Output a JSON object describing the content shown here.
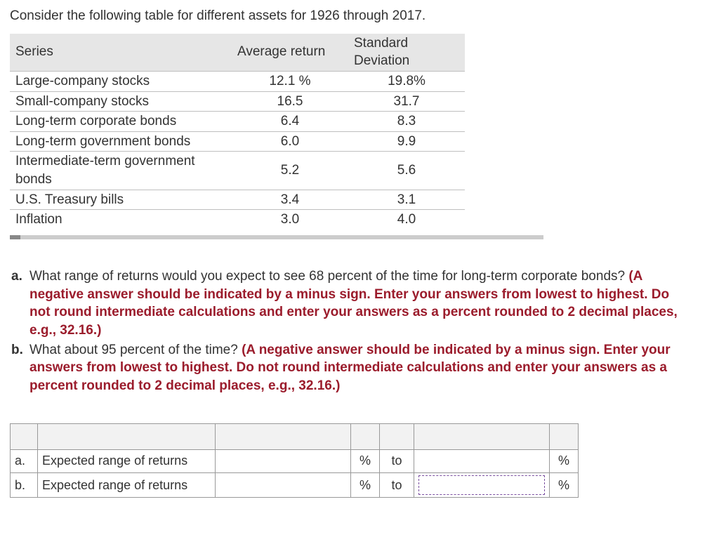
{
  "prompt": "Consider the following table for different assets for 1926 through 2017.",
  "table": {
    "headers": [
      "Series",
      "Average return",
      "Standard Deviation"
    ],
    "rows": [
      {
        "series": "Large-company stocks",
        "avg": "12.1 %",
        "sd": "19.8%"
      },
      {
        "series": "Small-company stocks",
        "avg": "16.5",
        "sd": "31.7"
      },
      {
        "series": "Long-term corporate bonds",
        "avg": "6.4",
        "sd": "8.3"
      },
      {
        "series": "Long-term government bonds",
        "avg": "6.0",
        "sd": "9.9"
      },
      {
        "series": "Intermediate-term government bonds",
        "avg": "5.2",
        "sd": "5.6"
      },
      {
        "series": "U.S. Treasury bills",
        "avg": "3.4",
        "sd": "3.1"
      },
      {
        "series": "Inflation",
        "avg": "3.0",
        "sd": "4.0"
      }
    ]
  },
  "questions": {
    "a": {
      "marker": "a.",
      "text": "What range of returns would you expect to see 68 percent of the time for long-term corporate bonds? ",
      "instr": "(A negative answer should be indicated by a minus sign. Enter your answers from lowest to highest. Do not round intermediate calculations and enter your answers as a percent rounded to 2 decimal places, e.g., 32.16.)"
    },
    "b": {
      "marker": "b.",
      "text": "What about 95 percent of the time? ",
      "instr": "(A negative answer should be indicated by a minus sign. Enter your answers from lowest to highest. Do not round intermediate calculations and enter your answers as a percent rounded to 2 decimal places, e.g., 32.16.)"
    }
  },
  "answer_table": {
    "rows": [
      {
        "idx": "a.",
        "label": "Expected range of returns",
        "pct": "%",
        "to": "to"
      },
      {
        "idx": "b.",
        "label": "Expected range of returns",
        "pct": "%",
        "to": "to"
      }
    ]
  },
  "chart_data": {
    "type": "table",
    "title": "Asset returns 1926–2017",
    "columns": [
      "Series",
      "Average return (%)",
      "Standard Deviation (%)"
    ],
    "rows": [
      [
        "Large-company stocks",
        12.1,
        19.8
      ],
      [
        "Small-company stocks",
        16.5,
        31.7
      ],
      [
        "Long-term corporate bonds",
        6.4,
        8.3
      ],
      [
        "Long-term government bonds",
        6.0,
        9.9
      ],
      [
        "Intermediate-term government bonds",
        5.2,
        5.6
      ],
      [
        "U.S. Treasury bills",
        3.4,
        3.1
      ],
      [
        "Inflation",
        3.0,
        4.0
      ]
    ]
  }
}
